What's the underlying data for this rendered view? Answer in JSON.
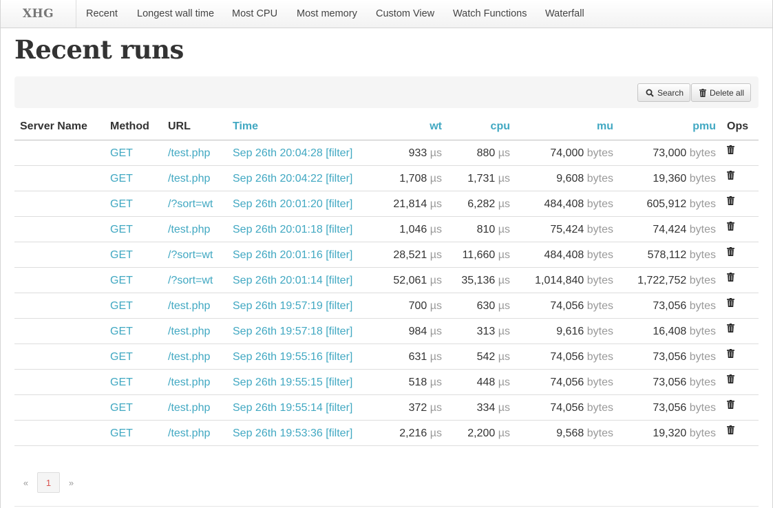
{
  "navbar": {
    "brand": "XHG",
    "items": [
      "Recent",
      "Longest wall time",
      "Most CPU",
      "Most memory",
      "Custom View",
      "Watch Functions",
      "Waterfall"
    ]
  },
  "page_title": "Recent runs",
  "toolbar": {
    "search_label": "Search",
    "delete_all_label": "Delete all"
  },
  "table": {
    "headers": {
      "server": "Server Name",
      "method": "Method",
      "url": "URL",
      "time": "Time",
      "wt": "wt",
      "cpu": "cpu",
      "mu": "mu",
      "pmu": "pmu",
      "ops": "Ops"
    },
    "units": {
      "time": "µs",
      "memory": "bytes",
      "filter": "[filter]"
    },
    "rows": [
      {
        "server": "",
        "method": "GET",
        "url": "/test.php",
        "time": "Sep 26th 20:04:28",
        "wt": "933",
        "cpu": "880",
        "mu": "74,000",
        "pmu": "73,000"
      },
      {
        "server": "",
        "method": "GET",
        "url": "/test.php",
        "time": "Sep 26th 20:04:22",
        "wt": "1,708",
        "cpu": "1,731",
        "mu": "9,608",
        "pmu": "19,360"
      },
      {
        "server": "",
        "method": "GET",
        "url": "/?sort=wt",
        "time": "Sep 26th 20:01:20",
        "wt": "21,814",
        "cpu": "6,282",
        "mu": "484,408",
        "pmu": "605,912"
      },
      {
        "server": "",
        "method": "GET",
        "url": "/test.php",
        "time": "Sep 26th 20:01:18",
        "wt": "1,046",
        "cpu": "810",
        "mu": "75,424",
        "pmu": "74,424"
      },
      {
        "server": "",
        "method": "GET",
        "url": "/?sort=wt",
        "time": "Sep 26th 20:01:16",
        "wt": "28,521",
        "cpu": "11,660",
        "mu": "484,408",
        "pmu": "578,112"
      },
      {
        "server": "",
        "method": "GET",
        "url": "/?sort=wt",
        "time": "Sep 26th 20:01:14",
        "wt": "52,061",
        "cpu": "35,136",
        "mu": "1,014,840",
        "pmu": "1,722,752"
      },
      {
        "server": "",
        "method": "GET",
        "url": "/test.php",
        "time": "Sep 26th 19:57:19",
        "wt": "700",
        "cpu": "630",
        "mu": "74,056",
        "pmu": "73,056"
      },
      {
        "server": "",
        "method": "GET",
        "url": "/test.php",
        "time": "Sep 26th 19:57:18",
        "wt": "984",
        "cpu": "313",
        "mu": "9,616",
        "pmu": "16,408"
      },
      {
        "server": "",
        "method": "GET",
        "url": "/test.php",
        "time": "Sep 26th 19:55:16",
        "wt": "631",
        "cpu": "542",
        "mu": "74,056",
        "pmu": "73,056"
      },
      {
        "server": "",
        "method": "GET",
        "url": "/test.php",
        "time": "Sep 26th 19:55:15",
        "wt": "518",
        "cpu": "448",
        "mu": "74,056",
        "pmu": "73,056"
      },
      {
        "server": "",
        "method": "GET",
        "url": "/test.php",
        "time": "Sep 26th 19:55:14",
        "wt": "372",
        "cpu": "334",
        "mu": "74,056",
        "pmu": "73,056"
      },
      {
        "server": "",
        "method": "GET",
        "url": "/test.php",
        "time": "Sep 26th 19:53:36",
        "wt": "2,216",
        "cpu": "2,200",
        "mu": "9,568",
        "pmu": "19,320"
      }
    ]
  },
  "pagination": {
    "prev": "«",
    "current": "1",
    "next": "»"
  },
  "colors": {
    "link": "#41a8c2",
    "muted": "#999999",
    "active_page": "#d9534f"
  },
  "icons": {
    "search": "search-icon",
    "trash": "trash-icon"
  }
}
